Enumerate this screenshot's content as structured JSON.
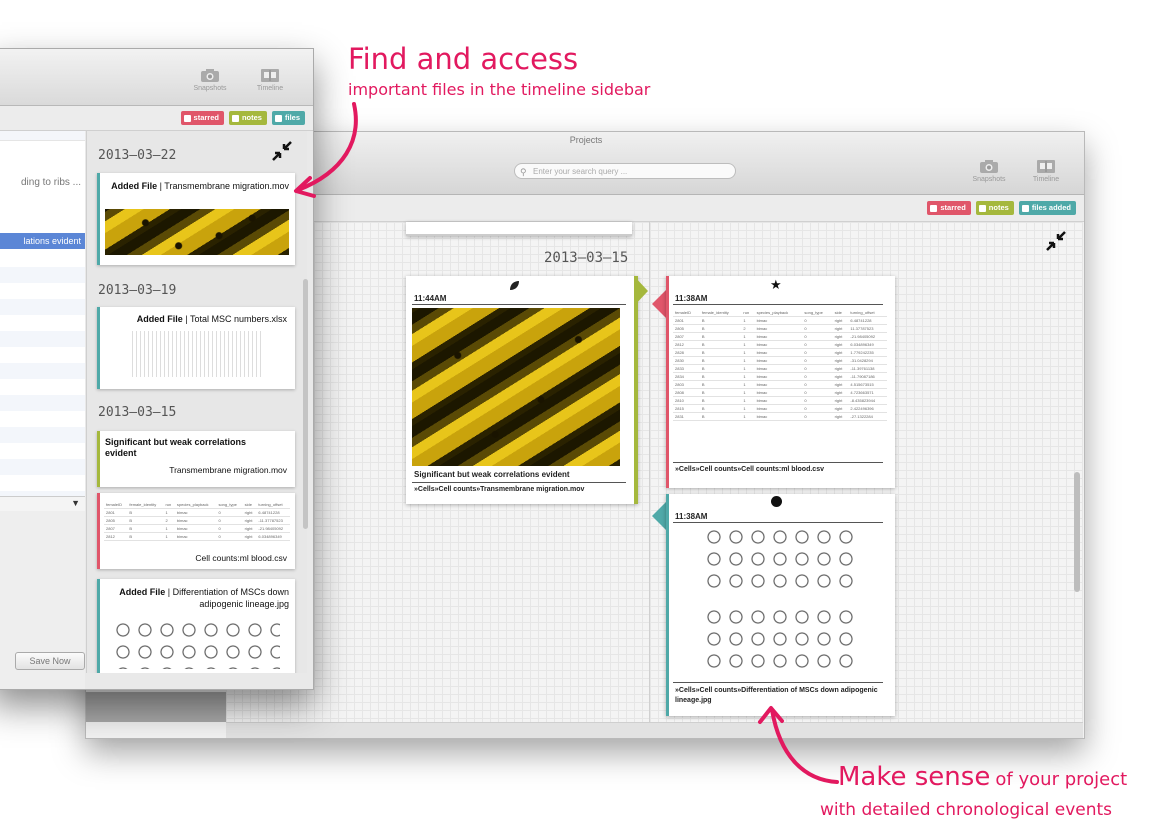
{
  "main_window": {
    "title": "Projects",
    "search_placeholder": "Enter your search query ...",
    "toolbar": {
      "snapshots_label": "Snapshots",
      "timeline_label": "Timeline"
    },
    "filters": [
      {
        "label": "starred",
        "color": "#e0566a"
      },
      {
        "label": "notes",
        "color": "#a5b83d"
      },
      {
        "label": "files added",
        "color": "#4fa9a8"
      }
    ],
    "date_heading": "2013–03–15",
    "cards": {
      "left": {
        "time": "11:44AM",
        "icon": "leaf-icon",
        "caption": "Significant but weak correlations evident",
        "path": "»Cells»Cell counts»Transmembrane migration.mov"
      },
      "right_top": {
        "time": "11:38AM",
        "icon": "star-icon",
        "path": "»Cells»Cell counts»Cell counts:ml blood.csv",
        "table_headers": [
          "femaleID",
          "female_identity",
          "run",
          "species_playback",
          "song_type",
          "side",
          "turning_offset"
        ],
        "table_rows": [
          [
            "2801",
            "B",
            "1",
            "bimac",
            "0",
            "right",
            "6.48741228"
          ],
          [
            "2805",
            "B",
            "2",
            "bimac",
            "0",
            "right",
            "11.37787523"
          ],
          [
            "2807",
            "B",
            "1",
            "bimac",
            "0",
            "right",
            "-21.98405092"
          ],
          [
            "2812",
            "B",
            "1",
            "bimac",
            "0",
            "right",
            "6.034896349"
          ],
          [
            "2828",
            "B",
            "1",
            "bimac",
            "0",
            "right",
            "1.779242235"
          ],
          [
            "2830",
            "B",
            "1",
            "bimac",
            "0",
            "right",
            "-31.0428294"
          ],
          [
            "2833",
            "B",
            "1",
            "bimac",
            "0",
            "right",
            "-11.39761138"
          ],
          [
            "2834",
            "B",
            "1",
            "bimac",
            "0",
            "right",
            "-11.79087186"
          ],
          [
            "2803",
            "B",
            "1",
            "bimac",
            "0",
            "right",
            "4.515673515"
          ],
          [
            "2808",
            "B",
            "1",
            "bimac",
            "0",
            "right",
            "4.723663571"
          ],
          [
            "2810",
            "B",
            "1",
            "bimac",
            "0",
            "right",
            "-8.435823944"
          ],
          [
            "2815",
            "B",
            "1",
            "bimac",
            "0",
            "right",
            "2.422496396"
          ],
          [
            "2831",
            "B",
            "1",
            "bimac",
            "0",
            "right",
            "-27.1322284"
          ]
        ]
      },
      "right_bottom": {
        "time": "11:38AM",
        "icon": "dot-icon",
        "path": "»Cells»Cell counts»Differentiation of MSCs down adipogenic lineage.jpg"
      }
    }
  },
  "front_window": {
    "toolbar": {
      "snapshots_label": "Snapshots",
      "timeline_label": "Timeline"
    },
    "filters": [
      {
        "label": "starred",
        "color": "#e0566a"
      },
      {
        "label": "notes",
        "color": "#a5b83d"
      },
      {
        "label": "files",
        "color": "#4fa9a8"
      }
    ],
    "left_list": {
      "item1": "ding to ribs ...",
      "item2": "lations evident",
      "save_button": "Save Now"
    },
    "sections": [
      {
        "date": "2013–03–22"
      },
      {
        "date": "2013–03–19"
      },
      {
        "date": "2013–03–15"
      }
    ],
    "cards": {
      "c1": {
        "prefix": "Added File",
        "text": "Transmembrane migration.mov"
      },
      "c2": {
        "prefix": "Added File",
        "text": "Total MSC numbers.xlsx"
      },
      "c3": {
        "title": "Significant but weak correlations evident",
        "file": "Transmembrane migration.mov"
      },
      "c4": {
        "file": "Cell counts:ml blood.csv",
        "table_headers": [
          "femaleID",
          "female_identity",
          "run",
          "species_playback",
          "song_type",
          "side",
          "turning_offset"
        ],
        "table_rows": [
          [
            "2801",
            "B",
            "1",
            "bimac",
            "0",
            "right",
            "6.48741228"
          ],
          [
            "2805",
            "B",
            "2",
            "bimac",
            "0",
            "right",
            "-11.37787523"
          ],
          [
            "2807",
            "B",
            "1",
            "bimac",
            "0",
            "right",
            "-21.98405092"
          ],
          [
            "2812",
            "B",
            "1",
            "bimac",
            "0",
            "right",
            "6.034896349"
          ]
        ]
      },
      "c5": {
        "prefix": "Added File",
        "text": "Differentiation of MSCs down adipogenic lineage.jpg"
      }
    }
  },
  "annotations": {
    "top_line1": "Find and access",
    "top_line2": "important files in the timeline sidebar",
    "bottom_line1_big": "Make sense",
    "bottom_line1_rest": "of your project",
    "bottom_line2": "with detailed chronological events",
    "color": "#e2195f"
  }
}
